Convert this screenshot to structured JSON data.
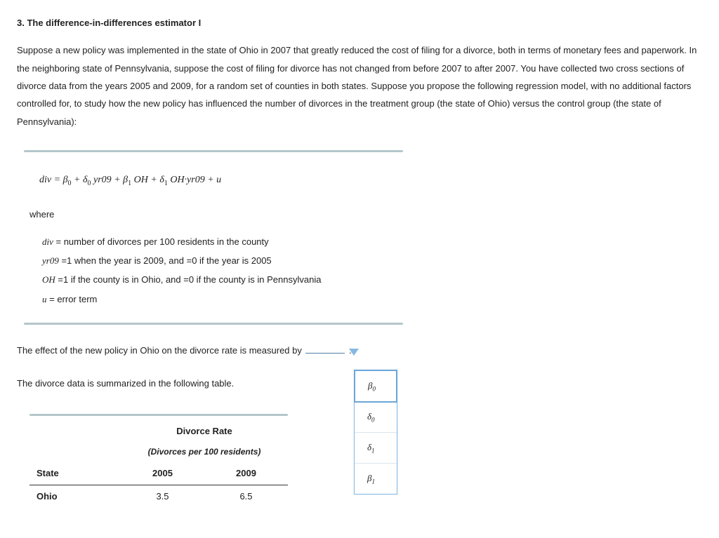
{
  "title": "3. The difference-in-differences estimator I",
  "intro": "Suppose a new policy was implemented in the state of Ohio in 2007 that greatly reduced the cost of filing for a divorce, both in terms of monetary fees and paperwork. In the neighboring state of Pennsylvania, suppose the cost of filing for divorce has not changed from before 2007 to after 2007. You have collected two cross sections of divorce data from the years 2005 and 2009, for a random set of counties in both states. Suppose you propose the following regression model, with no additional factors controlled for, to study how the new policy has influenced the number of divorces in the treatment group (the state of Ohio) versus the control group (the state of Pennsylvania):",
  "equation": {
    "lhs": "div",
    "eq": " = ",
    "t1a": "β",
    "t1s": "0",
    "plus1": " + ",
    "t2a": "δ",
    "t2s": "0",
    "t2v": " yr09",
    "plus2": " + ",
    "t3a": "β",
    "t3s": "1",
    "t3v": " OH",
    "plus3": " + ",
    "t4a": "δ",
    "t4s": "1",
    "t4v": " OH·yr09",
    "plus4": " + ",
    "t5": "u"
  },
  "where_label": "where",
  "defs": {
    "d1_sym": "div",
    "d1_txt": " = number of divorces per 100 residents in the county",
    "d2_sym": "yr09",
    "d2_txt": " =1 when the year is 2009, and =0 if the year is 2005",
    "d3_sym": "OH",
    "d3_txt": " =1 if the county is in Ohio, and =0 if the county is in Pennsylvania",
    "d4_sym": "u",
    "d4_txt": " = error term"
  },
  "q1_pre": "The effect of the new policy in Ohio on the divorce rate is measured by ",
  "q1_post": " .",
  "q2": "The divorce data is summarized in the following table.",
  "options": {
    "o1a": "β",
    "o1s": "0",
    "o2a": "δ",
    "o2s": "0",
    "o3a": "δ",
    "o3s": "1",
    "o4a": "β",
    "o4s": "1"
  },
  "table": {
    "hdr_main": "Divorce Rate",
    "hdr_sub": "(Divorces per 100 residents)",
    "col_state": "State",
    "col_y1": "2005",
    "col_y2": "2009",
    "row1_state": "Ohio",
    "row1_y1": "3.5",
    "row1_y2": "6.5"
  }
}
